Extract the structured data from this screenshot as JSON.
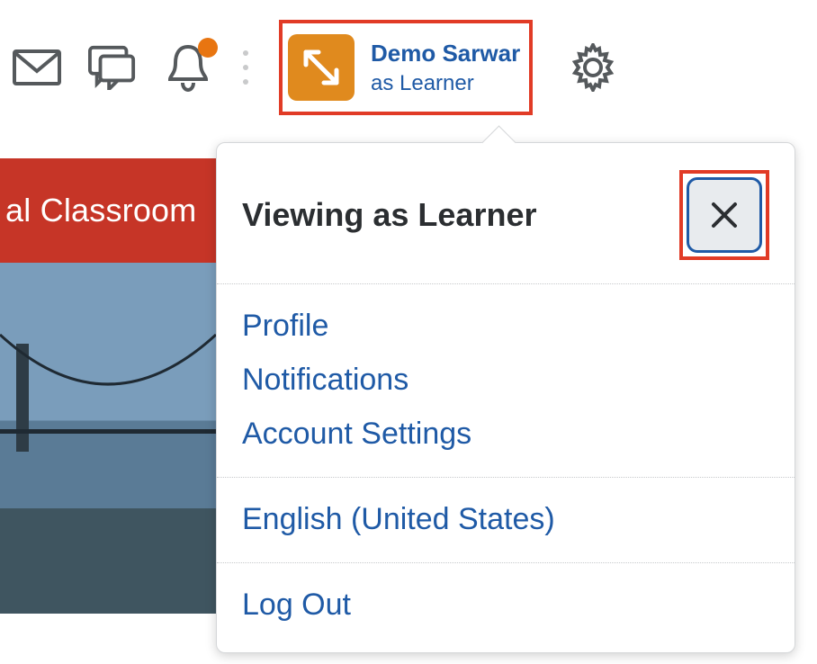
{
  "nav": {
    "user_name": "Demo Sarwar",
    "user_role": "as Learner"
  },
  "banner": {
    "title_fragment": "al Classroom"
  },
  "menu": {
    "header": "Viewing as Learner",
    "links": {
      "profile": "Profile",
      "notifications": "Notifications",
      "account_settings": "Account Settings",
      "language": "English (United States)",
      "logout": "Log Out"
    }
  }
}
